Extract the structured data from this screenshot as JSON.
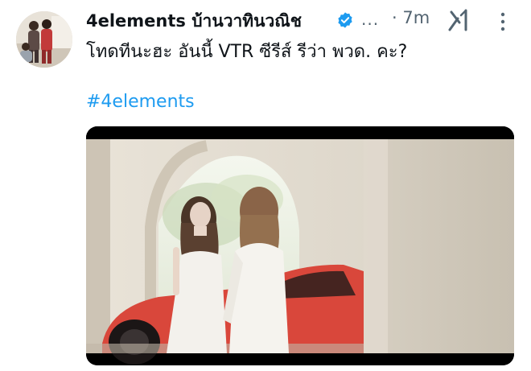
{
  "tweet": {
    "author_name": "4elements บ้านวาทินวณิช",
    "verified": true,
    "ellipsis": "...",
    "time": "· 7m",
    "text": "โทดทีนะฮะ อันนี้ VTR ซีรีส์ รีว่า พวด. คะ?",
    "hashtag": "#4elements"
  },
  "icons": {
    "badge": "verified-badge-icon",
    "grok": "grok-xai-icon",
    "more": "more-vertical-icon"
  },
  "colors": {
    "accent": "#1d9bf0",
    "secondary_text": "#536471",
    "primary_text": "#0f1419"
  }
}
